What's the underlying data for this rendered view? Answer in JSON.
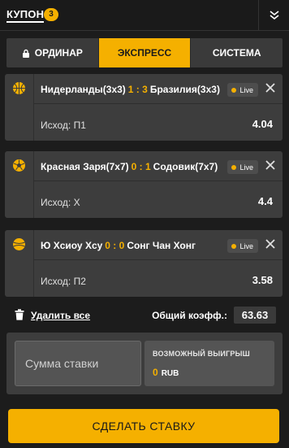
{
  "header": {
    "title": "КУПОН",
    "count": "3"
  },
  "tabs": [
    {
      "label": "ОРДИНАР",
      "icon": "lock-icon",
      "active": false
    },
    {
      "label": "ЭКСПРЕСС",
      "active": true
    },
    {
      "label": "СИСТЕМА",
      "active": false
    }
  ],
  "bets": [
    {
      "team1": "Нидерланды(3x3)",
      "score": "1 : 3",
      "team2": "Бразилия(3x3)",
      "live": "Live",
      "outcome": "Исход: П1",
      "odds": "4.04",
      "sport_icon": "basketball-icon"
    },
    {
      "team1": "Красная Заря(7x7)",
      "score": "0 : 1",
      "team2": "Содовик(7x7)",
      "live": "Live",
      "outcome": "Исход: X",
      "odds": "4.4",
      "sport_icon": "soccer-ball-icon"
    },
    {
      "team1": "Ю Хсиоу Хсу",
      "score": "0 : 0",
      "team2": "Сонг Чан Хонг",
      "live": "Live",
      "outcome": "Исход: П2",
      "odds": "3.58",
      "sport_icon": "tennis-ball-icon"
    }
  ],
  "summary": {
    "delete_all": "Удалить все",
    "total_label": "Общий коэфф.:",
    "total_value": "63.63"
  },
  "stake": {
    "placeholder": "Сумма ставки",
    "win_label": "возможный выигрыш",
    "win_amount": "0",
    "win_currency": "RUB"
  },
  "place_bet": "СДЕЛАТЬ СТАВКУ",
  "colors": {
    "accent": "#f5b000",
    "background": "#1c1c1c",
    "card": "#3d3d3d"
  }
}
